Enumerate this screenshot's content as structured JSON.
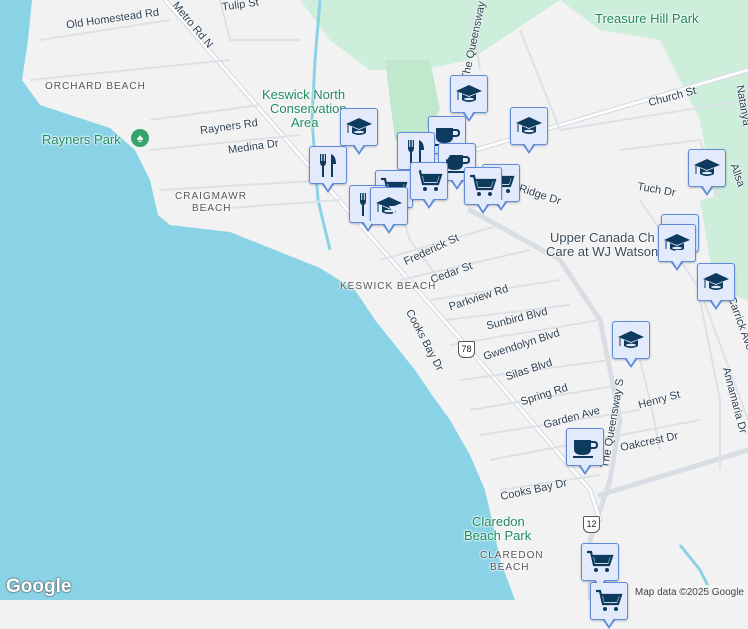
{
  "colors": {
    "water": "#8ad3e6",
    "land": "#f3f2f3",
    "park": "#cdeedb",
    "road": "#d9dee5",
    "pin_bg": "#e2eafc",
    "pin_border": "#5f8bd8",
    "icon": "#0e3a5d"
  },
  "roads": {
    "old_homestead": "Old Homestead Rd",
    "metro": "Metro Rd N",
    "tulip": "Tulip St",
    "queensway_n": "The Queensway N",
    "rayners": "Rayners Rd",
    "medina": "Medina Dr",
    "church": "Church St",
    "ridge": "Ridge Dr",
    "tuch": "Tuch Dr",
    "natanya": "Natanya",
    "allsa": "Allsa",
    "frederick": "Frederick St",
    "cedar": "Cedar St",
    "parkview": "Parkview Rd",
    "sunbird": "Sunbird Blvd",
    "gwendolyn": "Gwendolyn Blvd",
    "silas": "Silas Blvd",
    "spring": "Spring Rd",
    "garden": "Garden Ave",
    "henry": "Henry St",
    "oakcrest": "Oakcrest Dr",
    "cooks1": "Cooks Bay Dr",
    "cooks2": "Cooks Bay Dr",
    "queensway_s": "The Queensway S",
    "annamaria": "Annamaria Dr",
    "carrick": "Carrick Ave"
  },
  "areas": {
    "orchard": "ORCHARD BEACH",
    "craigmawr1": "CRAIGMAWR",
    "craigmawr2": "BEACH",
    "keswick": "KESWICK BEACH",
    "claredon1": "CLAREDON",
    "claredon2": "BEACH"
  },
  "parks": {
    "treasure": "Treasure Hill Park",
    "keswick_north1": "Keswick North",
    "keswick_north2": "Conservation",
    "keswick_north3": "Area",
    "rayners": "Rayners Park",
    "claredon1": "Claredon",
    "claredon2": "Beach Park"
  },
  "poi": {
    "upper_canada1": "Upper Canada Ch",
    "upper_canada2": "Care at WJ Watson P"
  },
  "shields": {
    "r78": "78",
    "r12": "12"
  },
  "footer": {
    "logo": "Google",
    "attribution": "Map data ©2025 Google"
  }
}
